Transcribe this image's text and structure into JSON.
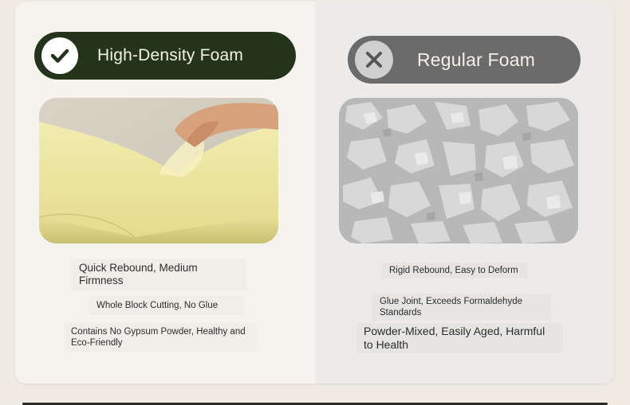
{
  "left": {
    "title": "High-Density Foam",
    "icon": "check-icon",
    "features": [
      "Quick Rebound, Medium Firmness",
      "Whole Block Cutting, No Glue",
      "Contains No Gypsum Powder, Healthy and Eco-Friendly"
    ]
  },
  "right": {
    "title": "Regular Foam",
    "icon": "close-icon",
    "features": [
      "Rigid Rebound, Easy to Deform",
      "Glue Joint, Exceeds Formaldehyde Standards",
      "Powder-Mixed, Easily Aged, Harmful to Health"
    ]
  },
  "colors": {
    "good_pill": "#24341a",
    "bad_pill": "#6b6b6b",
    "foam_yellow": "#e9e39a"
  }
}
